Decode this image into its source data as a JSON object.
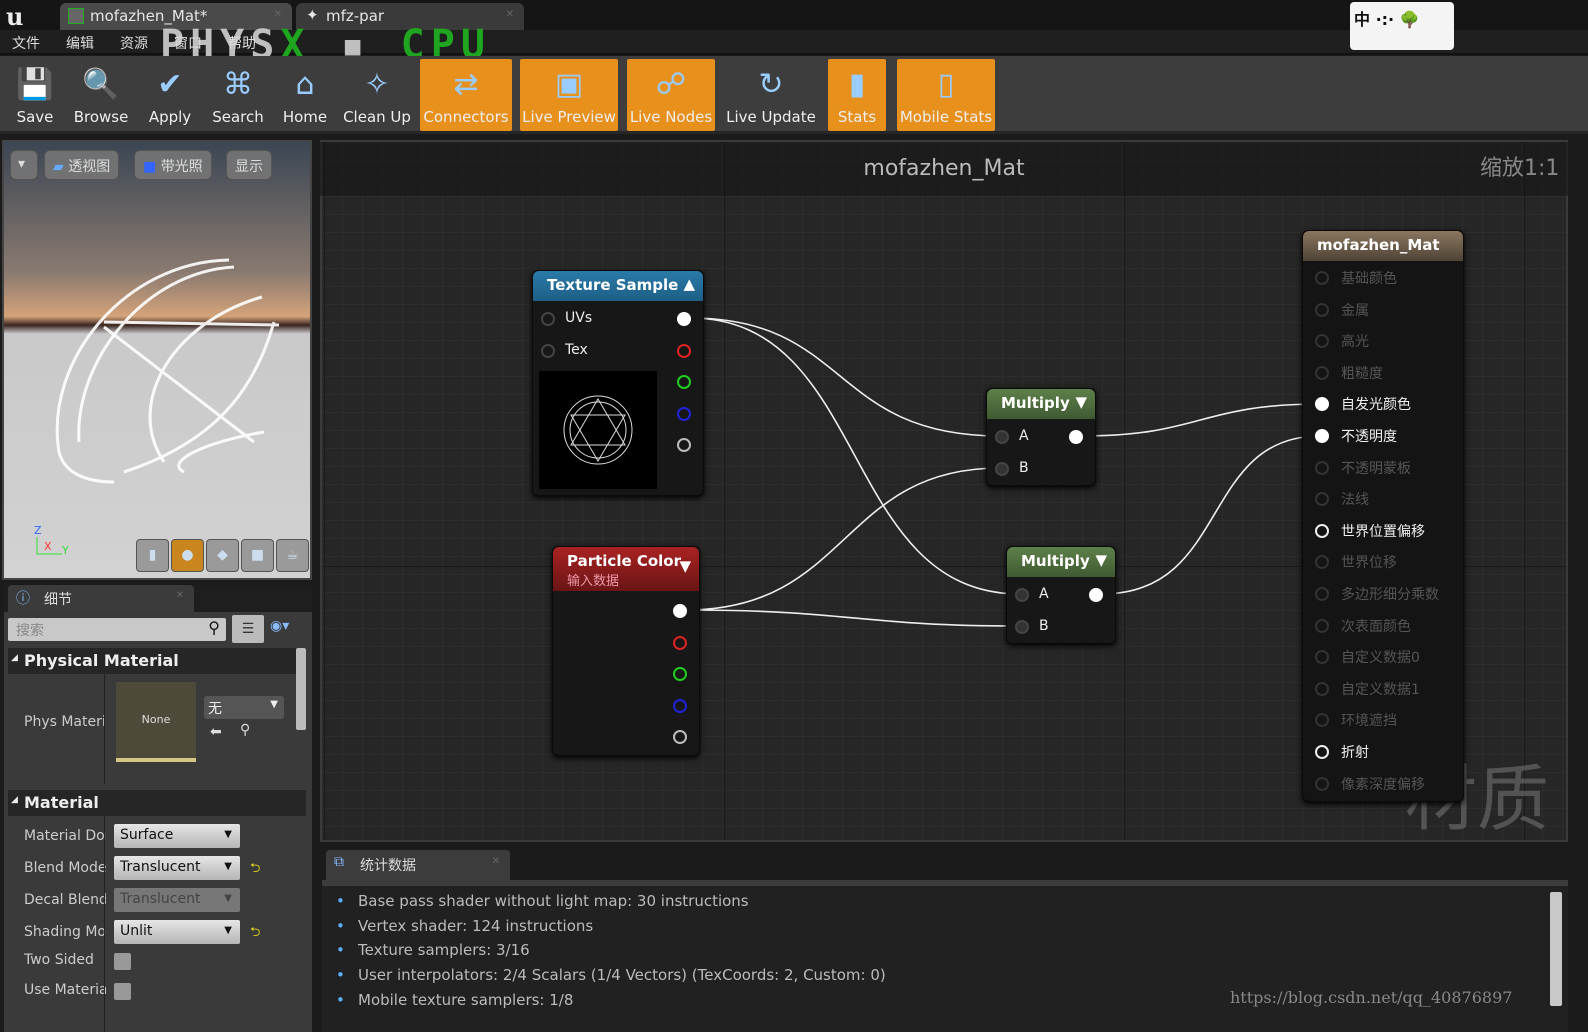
{
  "tabs": [
    {
      "label": "mofazhen_Mat*",
      "icon": "material-icon"
    },
    {
      "label": "mfz-par",
      "icon": "particle-icon"
    }
  ],
  "menu": [
    "文件",
    "编辑",
    "资源",
    "窗口",
    "帮助"
  ],
  "overlay": {
    "physx": "PHYS",
    "x": "X",
    "cpu": "CPU"
  },
  "logo": "中",
  "toolbar": [
    {
      "label": "Save",
      "icon": "save-icon",
      "active": false
    },
    {
      "label": "Browse",
      "icon": "browse-icon",
      "active": false
    },
    {
      "label": "Apply",
      "icon": "apply-icon",
      "active": false
    },
    {
      "label": "Search",
      "icon": "binoculars-icon",
      "active": false
    },
    {
      "label": "Home",
      "icon": "home-icon",
      "active": false
    },
    {
      "label": "Clean Up",
      "icon": "broom-icon",
      "active": false
    },
    {
      "label": "Connectors",
      "icon": "connectors-icon",
      "active": true
    },
    {
      "label": "Live Preview",
      "icon": "live-preview-icon",
      "active": true
    },
    {
      "label": "Live Nodes",
      "icon": "live-nodes-icon",
      "active": true
    },
    {
      "label": "Live Update",
      "icon": "live-update-icon",
      "active": false
    },
    {
      "label": "Stats",
      "icon": "stats-icon",
      "active": true
    },
    {
      "label": "Mobile Stats",
      "icon": "mobile-stats-icon",
      "active": true
    }
  ],
  "viewport": {
    "perspective": "透视图",
    "lit": "带光照",
    "show": "显示",
    "axes": {
      "z": "Z",
      "x": "X",
      "y": "Y"
    }
  },
  "details": {
    "tab": "细节",
    "search_placeholder": "搜索",
    "physical_material": {
      "header": "Physical Material",
      "label": "Phys Materi",
      "thumb": "None",
      "combo": "无"
    },
    "material": {
      "header": "Material",
      "rows": [
        {
          "label": "Material Dor",
          "value": "Surface",
          "enabled": true,
          "reset": false
        },
        {
          "label": "Blend Mode",
          "value": "Translucent",
          "enabled": true,
          "reset": true
        },
        {
          "label": "Decal Blend",
          "value": "Translucent",
          "enabled": false,
          "reset": false
        },
        {
          "label": "Shading Moc",
          "value": "Unlit",
          "enabled": true,
          "reset": true
        }
      ],
      "checks": [
        {
          "label": "Two Sided",
          "checked": false
        },
        {
          "label": "Use Materia",
          "checked": false
        }
      ]
    }
  },
  "graph": {
    "title": "mofazhen_Mat",
    "zoom": "缩放1:1",
    "watermark": "材质",
    "texture_sample": {
      "title": "Texture Sample",
      "inputs": [
        "UVs",
        "Tex"
      ]
    },
    "particle_color": {
      "title": "Particle Color",
      "subtitle": "输入数据"
    },
    "multiply1": {
      "title": "Multiply",
      "inputs": [
        "A",
        "B"
      ]
    },
    "multiply2": {
      "title": "Multiply",
      "inputs": [
        "A",
        "B"
      ]
    },
    "result": {
      "title": "mofazhen_Mat",
      "pins": [
        {
          "label": "基础颜色",
          "active": false,
          "connected": false
        },
        {
          "label": "金属",
          "active": false,
          "connected": false
        },
        {
          "label": "高光",
          "active": false,
          "connected": false
        },
        {
          "label": "粗糙度",
          "active": false,
          "connected": false
        },
        {
          "label": "自发光颜色",
          "active": true,
          "connected": true
        },
        {
          "label": "不透明度",
          "active": true,
          "connected": true
        },
        {
          "label": "不透明蒙板",
          "active": false,
          "connected": false
        },
        {
          "label": "法线",
          "active": false,
          "connected": false
        },
        {
          "label": "世界位置偏移",
          "active": true,
          "connected": false
        },
        {
          "label": "世界位移",
          "active": false,
          "connected": false
        },
        {
          "label": "多边形细分乘数",
          "active": false,
          "connected": false
        },
        {
          "label": "次表面颜色",
          "active": false,
          "connected": false
        },
        {
          "label": "自定义数据0",
          "active": false,
          "connected": false
        },
        {
          "label": "自定义数据1",
          "active": false,
          "connected": false
        },
        {
          "label": "环境遮挡",
          "active": false,
          "connected": false
        },
        {
          "label": "折射",
          "active": true,
          "connected": false
        },
        {
          "label": "像素深度偏移",
          "active": false,
          "connected": false
        }
      ]
    }
  },
  "stats": {
    "tab": "统计数据",
    "lines": [
      "Base pass shader without light map: 30 instructions",
      "Vertex shader: 124 instructions",
      "Texture samplers: 3/16",
      "User interpolators: 2/4 Scalars (1/4 Vectors) (TexCoords: 2, Custom: 0)",
      "Mobile texture samplers: 1/8"
    ]
  },
  "url": "https://blog.csdn.net/qq_40876897",
  "colors": {
    "accent": "#e8901c",
    "texture_header": "#1d5f86",
    "multiply_header": "#4c6a3d",
    "particle_header": "#7a1c1c",
    "result_header": "#6b5a46"
  }
}
